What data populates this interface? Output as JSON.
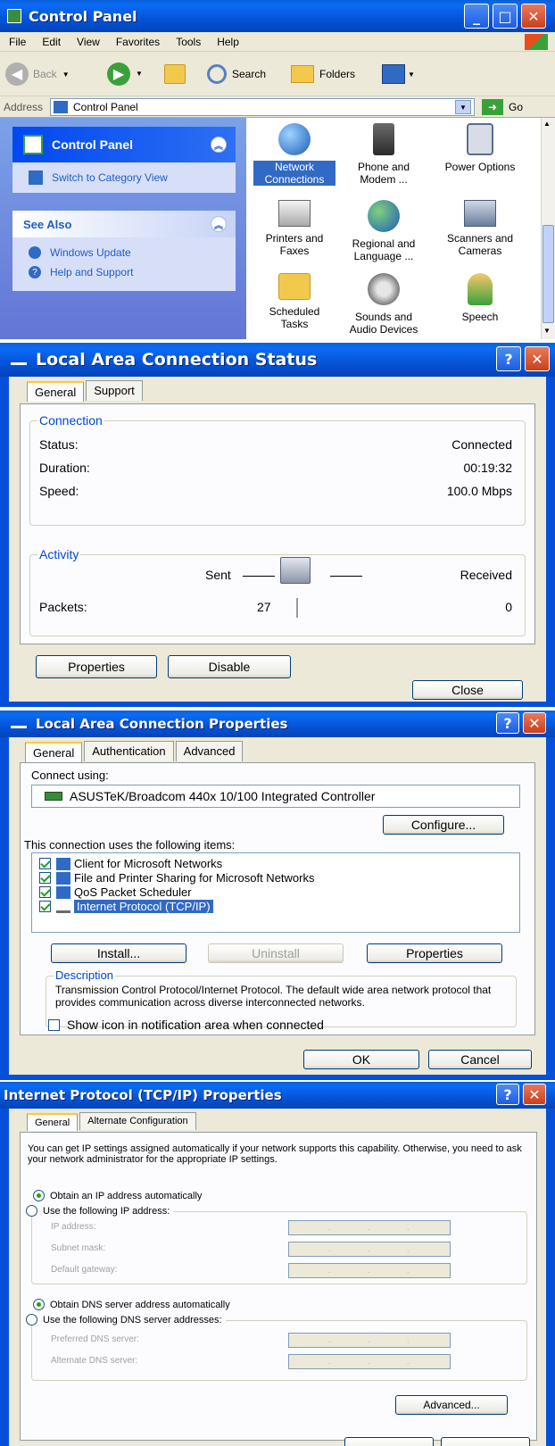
{
  "control_panel": {
    "title": "Control Panel",
    "menu": [
      "File",
      "Edit",
      "View",
      "Favorites",
      "Tools",
      "Help"
    ],
    "toolbar": {
      "back": "Back",
      "search": "Search",
      "folders": "Folders"
    },
    "address_label": "Address",
    "address_value": "Control Panel",
    "go": "Go",
    "task_panel": {
      "title": "Control Panel",
      "switch_view": "Switch to Category View"
    },
    "see_also": {
      "title": "See Also",
      "items": [
        "Windows Update",
        "Help and Support"
      ]
    },
    "items": [
      {
        "line1": "Network",
        "line2": "Connections"
      },
      {
        "line1": "Phone and",
        "line2": "Modem ..."
      },
      {
        "line1": "Power Options",
        "line2": ""
      },
      {
        "line1": "Printers and",
        "line2": "Faxes"
      },
      {
        "line1": "Regional and",
        "line2": "Language ..."
      },
      {
        "line1": "Scanners and",
        "line2": "Cameras"
      },
      {
        "line1": "Scheduled",
        "line2": "Tasks"
      },
      {
        "line1": "Sounds and",
        "line2": "Audio Devices"
      },
      {
        "line1": "Speech",
        "line2": ""
      }
    ]
  },
  "status_window": {
    "title": "Local Area Connection Status",
    "tabs": [
      "General",
      "Support"
    ],
    "connection_group": "Connection",
    "status_label": "Status:",
    "status_value": "Connected",
    "duration_label": "Duration:",
    "duration_value": "00:19:32",
    "speed_label": "Speed:",
    "speed_value": "100.0 Mbps",
    "activity_group": "Activity",
    "sent_label": "Sent",
    "received_label": "Received",
    "packets_label": "Packets:",
    "packets_sent": "27",
    "packets_received": "0",
    "properties_button": "Properties",
    "disable_button": "Disable",
    "close_button": "Close"
  },
  "properties_window": {
    "title": "Local Area Connection Properties",
    "tabs": [
      "General",
      "Authentication",
      "Advanced"
    ],
    "connect_using_label": "Connect using:",
    "adapter": "ASUSTeK/Broadcom 440x 10/100 Integrated Controller",
    "configure_button": "Configure...",
    "items_label": "This connection uses the following items:",
    "items": [
      "Client for Microsoft Networks",
      "File and Printer Sharing for Microsoft Networks",
      "QoS Packet Scheduler",
      "Internet Protocol (TCP/IP)"
    ],
    "install_button": "Install...",
    "uninstall_button": "Uninstall",
    "properties_button": "Properties",
    "description_group": "Description",
    "description_text": "Transmission Control Protocol/Internet Protocol. The default wide area network protocol that provides communication across diverse interconnected networks.",
    "show_icon_label": "Show icon in notification area when connected",
    "ok_button": "OK",
    "cancel_button": "Cancel"
  },
  "tcpip_window": {
    "title": "Internet Protocol (TCP/IP) Properties",
    "tabs": [
      "General",
      "Alternate Configuration"
    ],
    "intro": "You can get IP settings assigned automatically if your network supports this capability. Otherwise, you need to ask your network administrator for the appropriate IP settings.",
    "obtain_ip_auto": "Obtain an IP address automatically",
    "use_following_ip": "Use the following IP address:",
    "ip_address_label": "IP address:",
    "subnet_mask_label": "Subnet mask:",
    "default_gateway_label": "Default gateway:",
    "obtain_dns_auto": "Obtain DNS server address automatically",
    "use_following_dns": "Use the following DNS server addresses:",
    "preferred_dns_label": "Preferred DNS server:",
    "alternate_dns_label": "Alternate DNS server:",
    "advanced_button": "Advanced..."
  }
}
